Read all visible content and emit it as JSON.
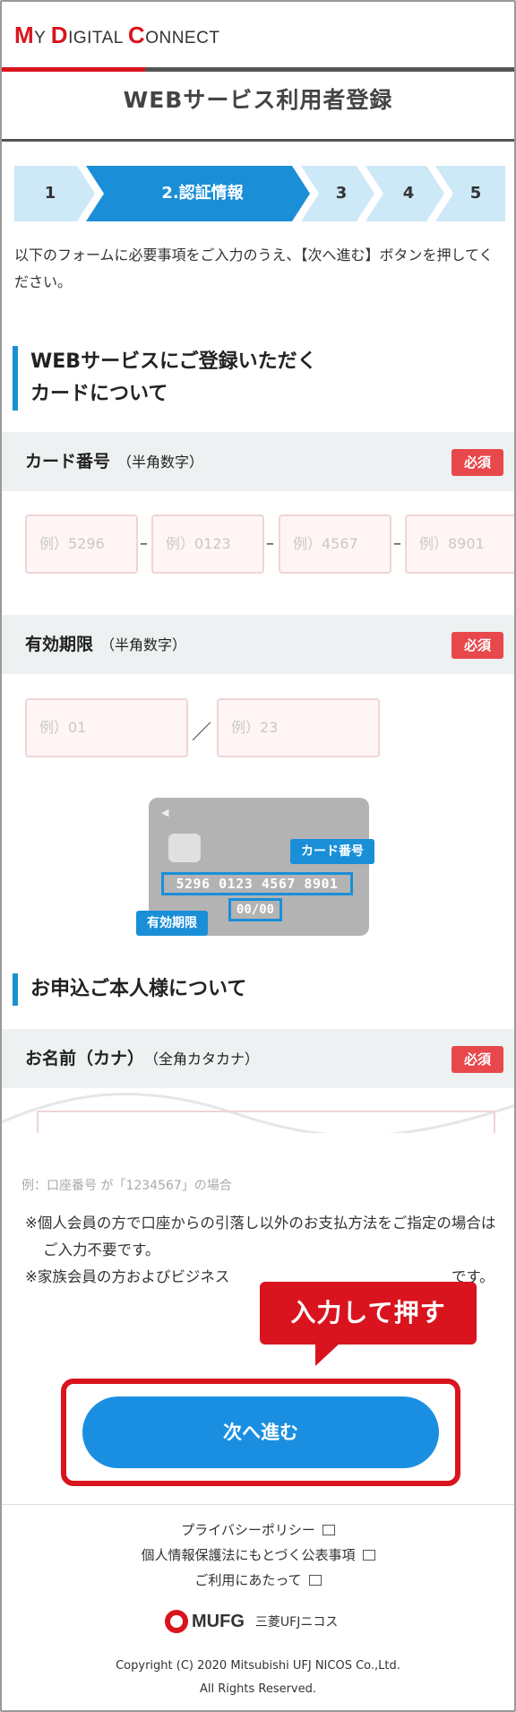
{
  "header": {
    "logo": {
      "w1_cap": "M",
      "w1_rest": "Y ",
      "w2_cap": "D",
      "w2_rest": "IGITAL ",
      "w3_cap": "C",
      "w3_rest": "ONNECT"
    },
    "page_title": "WEBサービス利用者登録"
  },
  "steps": [
    {
      "label": "1"
    },
    {
      "label": "2.認証情報"
    },
    {
      "label": "3"
    },
    {
      "label": "4"
    },
    {
      "label": "5"
    }
  ],
  "intro": "以下のフォームに必要事項をご入力のうえ、【次へ進む】ボタンを押してください。",
  "section_card": {
    "title_line1": "WEBサービスにご登録いただく",
    "title_line2": "カードについて"
  },
  "card_number": {
    "label": "カード番号",
    "sub": "（半角数字）",
    "required": "必須",
    "placeholders": [
      "例）5296",
      "例）0123",
      "例）4567",
      "例）8901"
    ],
    "separator": "–"
  },
  "expiry": {
    "label": "有効期限",
    "sub": "（半角数字）",
    "required": "必須",
    "placeholders": [
      "例）01",
      "例）23"
    ],
    "separator": "／"
  },
  "card_image": {
    "number": "5296 0123 4567 8901",
    "expiry": "00/00",
    "tag_number": "カード番号",
    "tag_expiry": "有効期限"
  },
  "section_person": {
    "title": "お申込ご本人様について"
  },
  "name_kana": {
    "label": "お名前（カナ）",
    "sub": "（全角カタカナ）",
    "required": "必須"
  },
  "notes": {
    "example": "例：口座番号 が「1234567」の場合",
    "lines": [
      "※個人会員の方で口座からの引落し以外のお支払方法をご指定の場合はご入力不要です。",
      "※家族会員の方およびビジネス　　　　　　　　　　　　　　　です。"
    ]
  },
  "callout": "入力して押す",
  "next_button": "次へ進む",
  "footer": {
    "links": [
      "プライバシーポリシー",
      "個人情報保護法にもとづく公表事項",
      "ご利用にあたって"
    ],
    "brand": "MUFG",
    "nicos": "三菱UFJニコス",
    "copyright": "Copyright (C) 2020 Mitsubishi UFJ NICOS Co.,Ltd.",
    "rights": "All Rights Reserved."
  },
  "colors": {
    "accent_red": "#d9141e",
    "primary_blue": "#1a8fe2",
    "step_inactive": "#cde8f7",
    "step_active": "#1a8fd8",
    "required_badge": "#e8484b"
  }
}
